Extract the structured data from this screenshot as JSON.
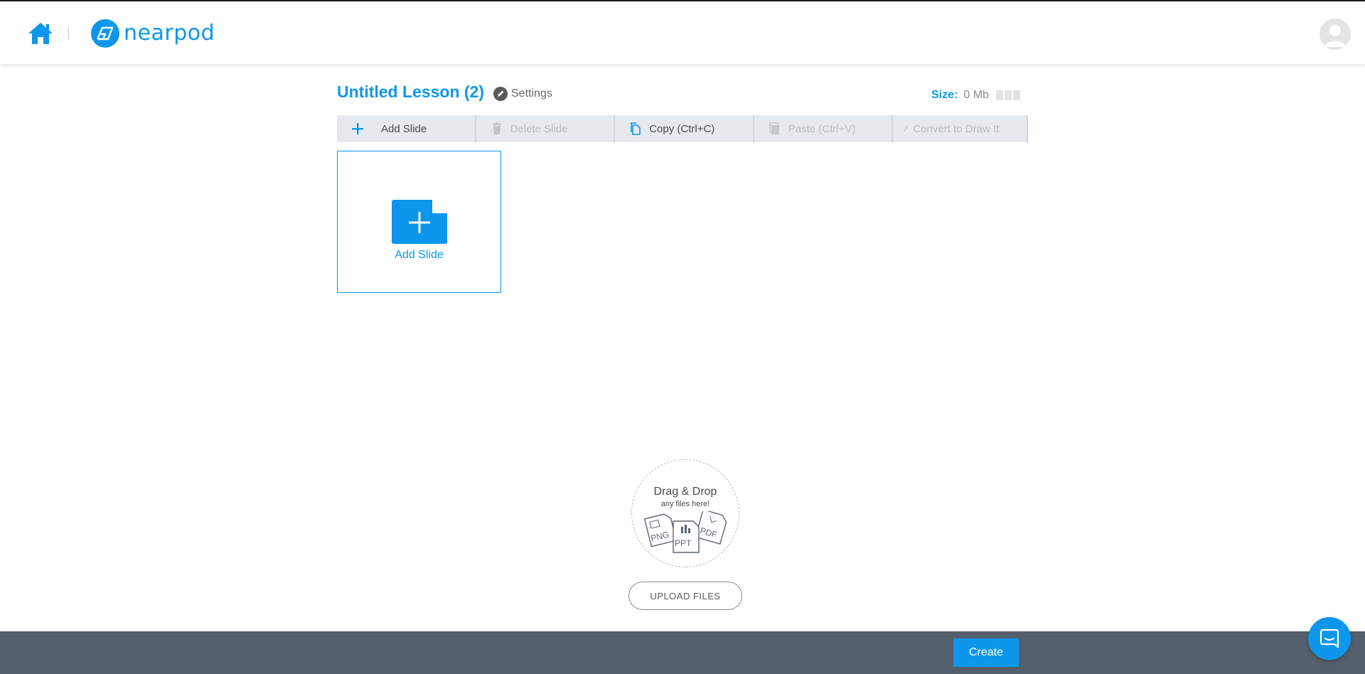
{
  "header": {
    "logo_text": "nearpod",
    "home_icon": "home-icon",
    "avatar_icon": "user-avatar-icon"
  },
  "lesson": {
    "title": "Untitled Lesson (2)",
    "settings_label": "Settings",
    "size_label": "Size:",
    "size_value": "0 Mb"
  },
  "toolbar": {
    "items": [
      {
        "label": "Add Slide",
        "icon": "plus-icon",
        "enabled": true
      },
      {
        "label": "Delete Slide",
        "icon": "trash-icon",
        "enabled": false
      },
      {
        "label": "Copy (Ctrl+C)",
        "icon": "copy-icon",
        "enabled": true
      },
      {
        "label": "Paste (Ctrl+V)",
        "icon": "paste-icon",
        "enabled": false
      },
      {
        "label": "Convert to Draw It",
        "icon": "pencil-icon",
        "enabled": false
      }
    ]
  },
  "slide_card": {
    "label": "Add Slide"
  },
  "dropzone": {
    "title": "Drag & Drop",
    "subtitle": "any files here!",
    "file_types": [
      "PNG",
      "PPT",
      "PDF"
    ]
  },
  "upload_button": "UPLOAD FILES",
  "footer": {
    "create_label": "Create"
  },
  "colors": {
    "accent": "#0c97ec",
    "footer": "#53606b",
    "toolbar_bg": "#e6eaee"
  }
}
